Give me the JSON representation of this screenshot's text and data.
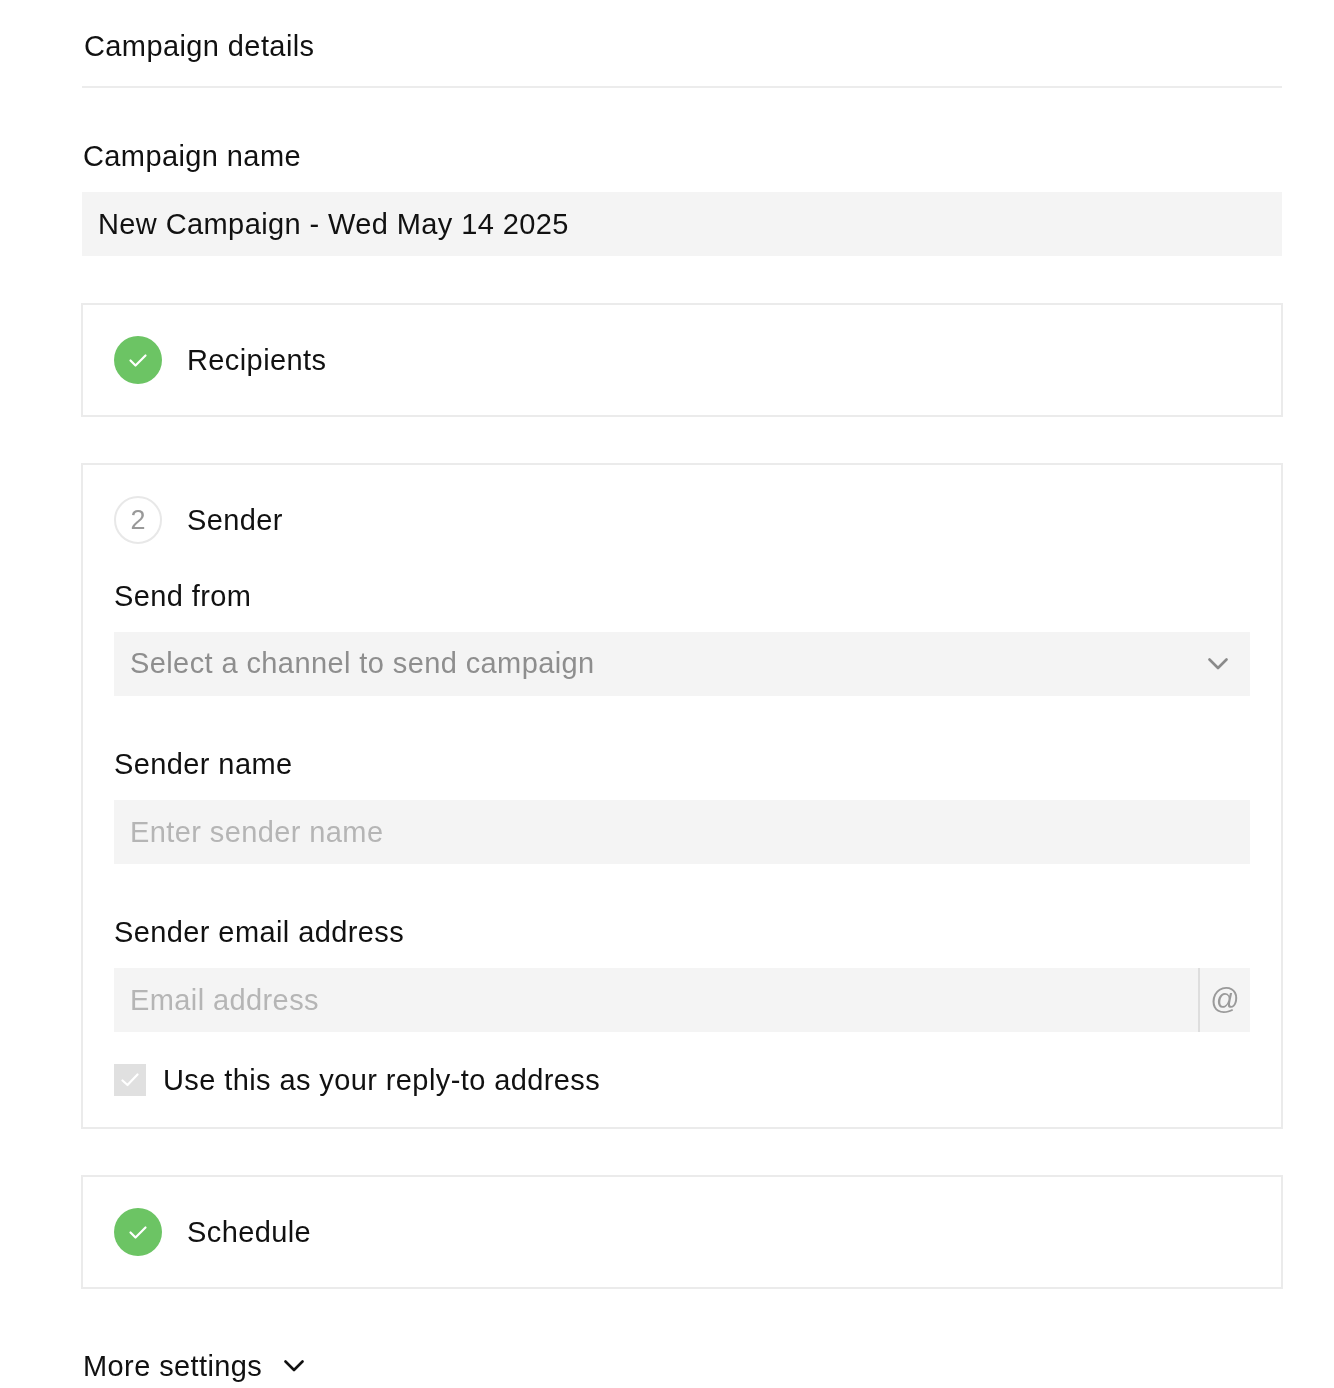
{
  "section": {
    "title": "Campaign details"
  },
  "campaign_name": {
    "label": "Campaign name",
    "value": "New Campaign - Wed May 14 2025"
  },
  "steps": [
    {
      "title": "Recipients",
      "completed": true
    },
    {
      "title": "Sender",
      "completed": false,
      "number": "2",
      "fields": [
        {
          "kind": "select",
          "label": "Send from",
          "placeholder": "Select a channel to send campaign"
        },
        {
          "kind": "text",
          "label": "Sender name",
          "placeholder": "Enter sender name"
        },
        {
          "kind": "email",
          "label": "Sender email address",
          "placeholder": "Email address",
          "addon": "@"
        }
      ],
      "checkbox": {
        "label": "Use this as your reply-to address",
        "checked": true,
        "disabled": true
      }
    },
    {
      "title": "Schedule",
      "completed": true
    }
  ],
  "more_settings": {
    "label": "More settings"
  }
}
